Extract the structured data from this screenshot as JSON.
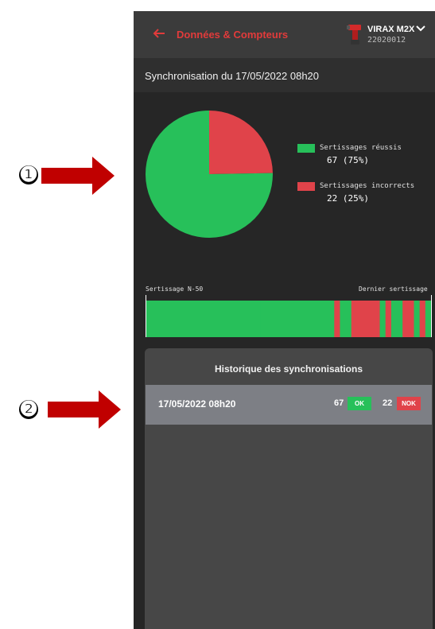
{
  "header": {
    "title": "Données & Compteurs",
    "device_name": "VIRAX M2X",
    "device_serial": "22020012",
    "back_icon": "arrow-left-icon",
    "device_icon": "crimping-tool-icon",
    "dropdown_icon": "chevron-down-icon"
  },
  "sync": {
    "title": "Synchronisation du 17/05/2022 08h20"
  },
  "chart_data": {
    "type": "pie",
    "slices": [
      {
        "label": "Sertissages réussis",
        "value": 67,
        "percent": 75,
        "color": "#27c05a"
      },
      {
        "label": "Sertissages incorrects",
        "value": 22,
        "percent": 25,
        "color": "#e0434a"
      }
    ]
  },
  "legend": {
    "ok_label": "Sertissages réussis",
    "ok_value": "67 (75%)",
    "nok_label": "Sertissages incorrects",
    "nok_value": "22 (25%)"
  },
  "history_bar": {
    "left_label": "Sertissage N-50",
    "right_label": "Dernier sertissage",
    "colors": {
      "ok": "#27c05a",
      "nok": "#e0434a"
    },
    "segments": [
      {
        "status": "ok",
        "count": 20
      },
      {
        "status": "ok",
        "count": 13
      },
      {
        "status": "nok",
        "count": 1
      },
      {
        "status": "ok",
        "count": 2
      },
      {
        "status": "nok",
        "count": 5
      },
      {
        "status": "ok",
        "count": 1
      },
      {
        "status": "nok",
        "count": 1
      },
      {
        "status": "ok",
        "count": 2
      },
      {
        "status": "nok",
        "count": 2
      },
      {
        "status": "ok",
        "count": 1
      },
      {
        "status": "nok",
        "count": 1
      },
      {
        "status": "ok",
        "count": 1
      }
    ]
  },
  "history": {
    "title": "Historique des synchronisations",
    "rows": [
      {
        "date": "17/05/2022 08h20",
        "ok_count": "67",
        "ok_badge": "OK",
        "nok_count": "22",
        "nok_badge": "NOK"
      }
    ]
  },
  "annotations": {
    "marker_1": "❶",
    "marker_2": "❷",
    "arrow_color": "#c00000"
  }
}
